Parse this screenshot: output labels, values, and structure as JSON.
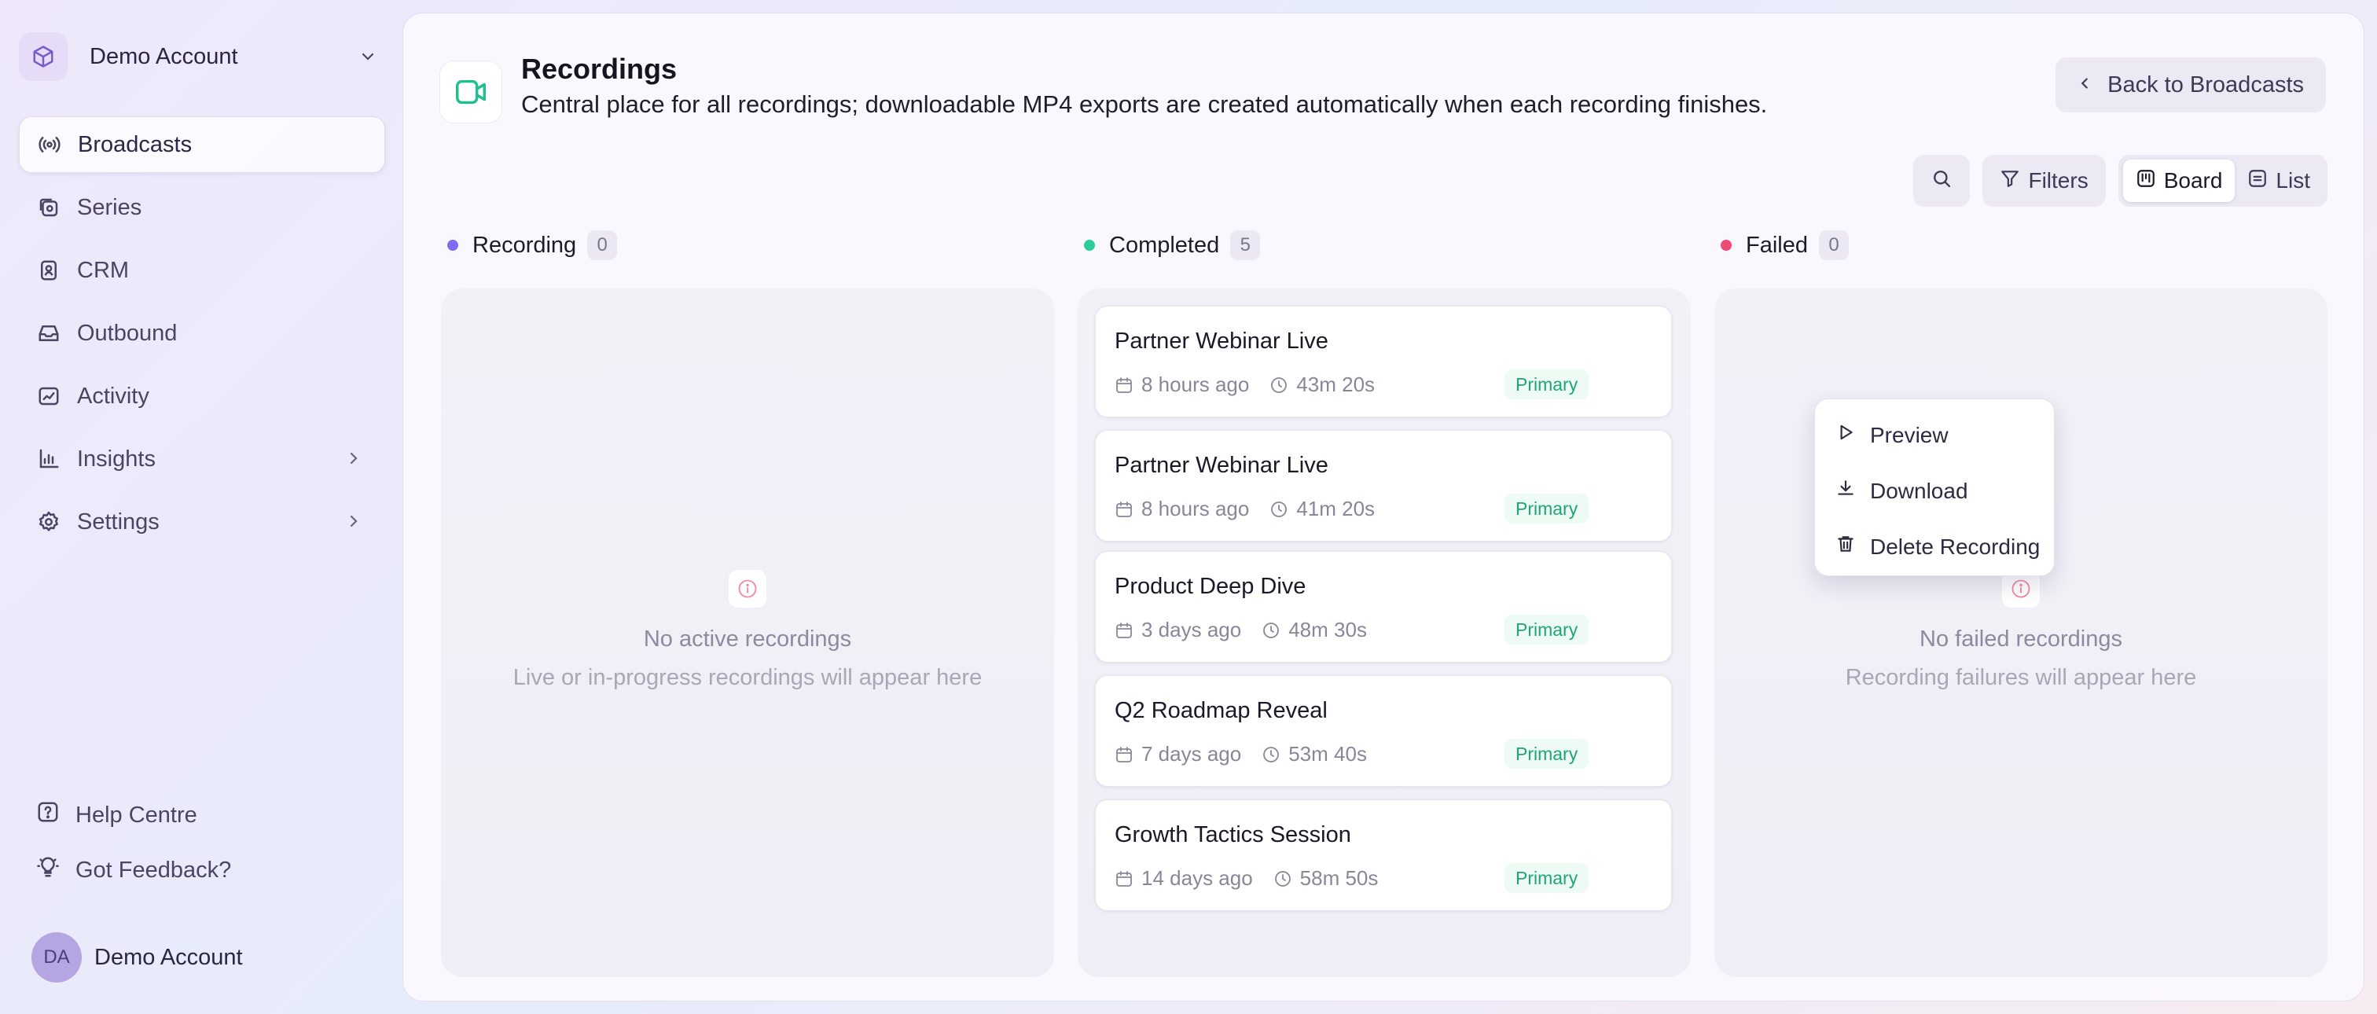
{
  "account": {
    "name": "Demo Account"
  },
  "nav": [
    {
      "label": "Broadcasts",
      "icon": "broadcast-icon",
      "active": true
    },
    {
      "label": "Series",
      "icon": "series-icon"
    },
    {
      "label": "CRM",
      "icon": "contact-icon"
    },
    {
      "label": "Outbound",
      "icon": "outbound-icon"
    },
    {
      "label": "Activity",
      "icon": "activity-icon"
    },
    {
      "label": "Insights",
      "icon": "insights-icon",
      "has_submenu": true
    },
    {
      "label": "Settings",
      "icon": "gear-icon",
      "has_submenu": true
    }
  ],
  "help": [
    {
      "label": "Help Centre",
      "icon": "help-icon"
    },
    {
      "label": "Got Feedback?",
      "icon": "lightbulb-icon"
    }
  ],
  "user": {
    "initials": "DA",
    "name": "Demo Account"
  },
  "header": {
    "title": "Recordings",
    "subtitle": "Central place for all recordings; downloadable MP4 exports are created automatically when each recording finishes.",
    "back_label": "Back to Broadcasts"
  },
  "toolbar": {
    "filters_label": "Filters",
    "views": [
      {
        "label": "Board",
        "active": true
      },
      {
        "label": "List",
        "active": false
      }
    ]
  },
  "colors": {
    "recording": "#7b6cf0",
    "completed": "#2ccb9c",
    "failed": "#ef4a74",
    "badge_text": "#20a676"
  },
  "columns": {
    "recording": {
      "title": "Recording",
      "count": "0",
      "empty_title": "No active recordings",
      "empty_subtitle": "Live or in-progress recordings will appear here"
    },
    "completed": {
      "title": "Completed",
      "count": "5",
      "cards": [
        {
          "title": "Partner Webinar Live",
          "age": "8 hours ago",
          "duration": "43m 20s",
          "badge": "Primary"
        },
        {
          "title": "Partner Webinar Live",
          "age": "8 hours ago",
          "duration": "41m 20s",
          "badge": "Primary"
        },
        {
          "title": "Product Deep Dive",
          "age": "3 days ago",
          "duration": "48m 30s",
          "badge": "Primary"
        },
        {
          "title": "Q2 Roadmap Reveal",
          "age": "7 days ago",
          "duration": "53m 40s",
          "badge": "Primary"
        },
        {
          "title": "Growth Tactics Session",
          "age": "14 days ago",
          "duration": "58m 50s",
          "badge": "Primary"
        }
      ]
    },
    "failed": {
      "title": "Failed",
      "count": "0",
      "empty_title": "No failed recordings",
      "empty_subtitle": "Recording failures will appear here"
    }
  },
  "context_menu": {
    "items": [
      {
        "label": "Preview",
        "icon": "play-icon"
      },
      {
        "label": "Download",
        "icon": "download-icon"
      },
      {
        "label": "Delete Recording",
        "icon": "trash-icon"
      }
    ]
  }
}
